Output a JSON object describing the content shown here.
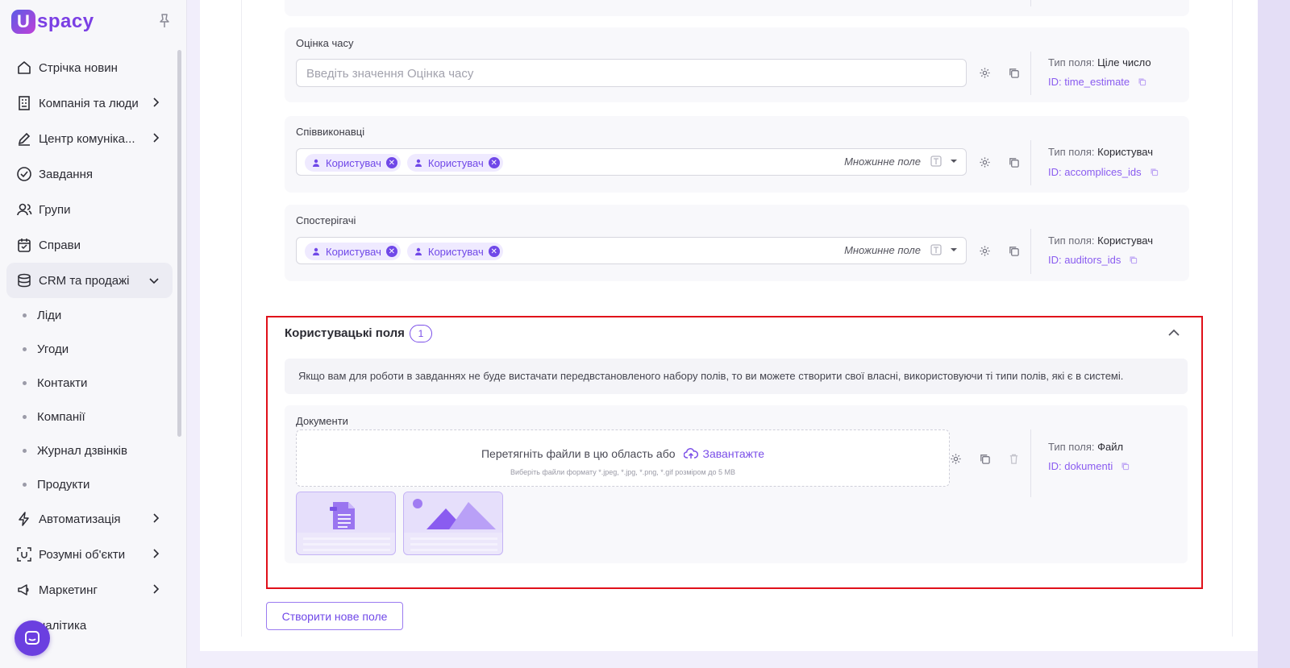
{
  "brand": {
    "logo_letter": "U",
    "logo_word": "spacy"
  },
  "sidebar": {
    "items": [
      {
        "label": "Стрічка новин",
        "icon": "home-icon",
        "has_chevron": false
      },
      {
        "label": "Компанія та люди",
        "icon": "building-icon",
        "has_chevron": true
      },
      {
        "label": "Центр комуніка...",
        "icon": "edit-icon",
        "has_chevron": true
      },
      {
        "label": "Завдання",
        "icon": "check-circle-icon",
        "has_chevron": false
      },
      {
        "label": "Групи",
        "icon": "users-icon",
        "has_chevron": false
      },
      {
        "label": "Справи",
        "icon": "calendar-icon",
        "has_chevron": false
      },
      {
        "label": "CRM та продажі",
        "icon": "database-icon",
        "has_chevron": true,
        "expanded": true
      }
    ],
    "sub_items": [
      "Ліди",
      "Угоди",
      "Контакти",
      "Компанії",
      "Журнал дзвінків",
      "Продукти"
    ],
    "items_after": [
      {
        "label": "Автоматизація",
        "icon": "lightning-icon",
        "has_chevron": true
      },
      {
        "label": "Розумні об'єкти",
        "icon": "scan-icon",
        "has_chevron": true
      },
      {
        "label": "Маркетинг",
        "icon": "megaphone-icon",
        "has_chevron": true
      },
      {
        "label": "налітика",
        "icon": "chart-icon",
        "has_chevron": false
      }
    ]
  },
  "fields": {
    "time_estimate": {
      "label": "Оцінка часу",
      "placeholder": "Введіть значення Оцінка часу",
      "type_key": "Тип поля:",
      "type_value": "Ціле число",
      "id": "ID: time_estimate"
    },
    "accomplices": {
      "label": "Співвиконавці",
      "chips": [
        "Користувач",
        "Користувач"
      ],
      "multi_label": "Множинне поле",
      "type_key": "Тип поля:",
      "type_value": "Користувач",
      "id": "ID: accomplices_ids"
    },
    "auditors": {
      "label": "Спостерігачі",
      "chips": [
        "Користувач",
        "Користувач"
      ],
      "multi_label": "Множинне поле",
      "type_key": "Тип поля:",
      "type_value": "Користувач",
      "id": "ID: auditors_ids"
    }
  },
  "custom_fields": {
    "title": "Користувацькі поля",
    "count": "1",
    "info": "Якщо вам для роботи в завданнях не буде вистачати передвстановленого набору полів, то ви можете створити свої власні, використовуючи ті типи полів, які є в системі.",
    "document": {
      "label": "Документи",
      "drop_text": "Перетягніть файли в цю область або",
      "upload_label": "Завантажте",
      "hint": "Виберіть файли формату *.jpeg, *.jpg, *.png, *.gif розміром до 5 MB",
      "type_key": "Тип поля:",
      "type_value": "Файл",
      "id": "ID: dokumenti"
    }
  },
  "create_button": "Створити нове поле",
  "colors": {
    "accent": "#7048e8",
    "highlight_border": "#e0101a",
    "brand_gradient_start": "#5b5ce6",
    "brand_gradient_end": "#c040d8"
  }
}
